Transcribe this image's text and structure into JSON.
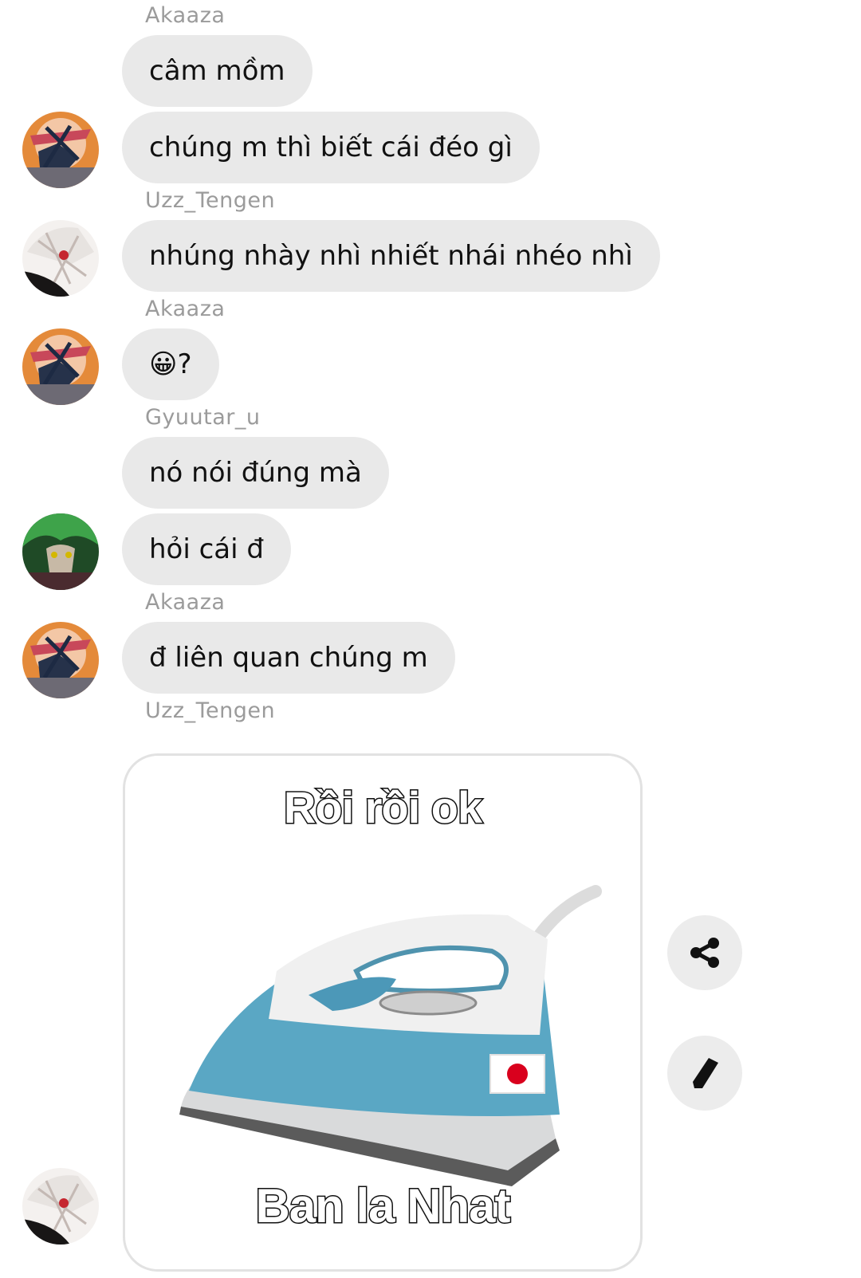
{
  "messages": {
    "m1": {
      "sender": "Akaaza",
      "text": "câm mồm"
    },
    "m2": {
      "text": "chúng m thì biết cái đéo gì"
    },
    "m3": {
      "sender": "Uzz_Tengen",
      "text": "nhúng nhày nhì nhiết nhái nhéo nhì"
    },
    "m4": {
      "sender": "Akaaza",
      "text": "😀?"
    },
    "m5": {
      "sender": "Gyuutar_u",
      "text": "nó nói đúng mà"
    },
    "m6": {
      "text": "hỏi cái đ"
    },
    "m7": {
      "sender": "Akaaza",
      "text": "đ liên quan chúng m"
    },
    "m8": {
      "sender": "Uzz_Tengen",
      "image_top_text": "Rồi rồi ok",
      "image_bottom_text": "Ban la Nhat"
    }
  },
  "actions": {
    "share_icon": "share-icon",
    "edit_icon": "pencil-icon"
  },
  "colors": {
    "bubble": "#e9e9e9",
    "sender": "#9b9b9b",
    "iron_blue": "#5aa7c4",
    "flag_red": "#d9001d"
  }
}
